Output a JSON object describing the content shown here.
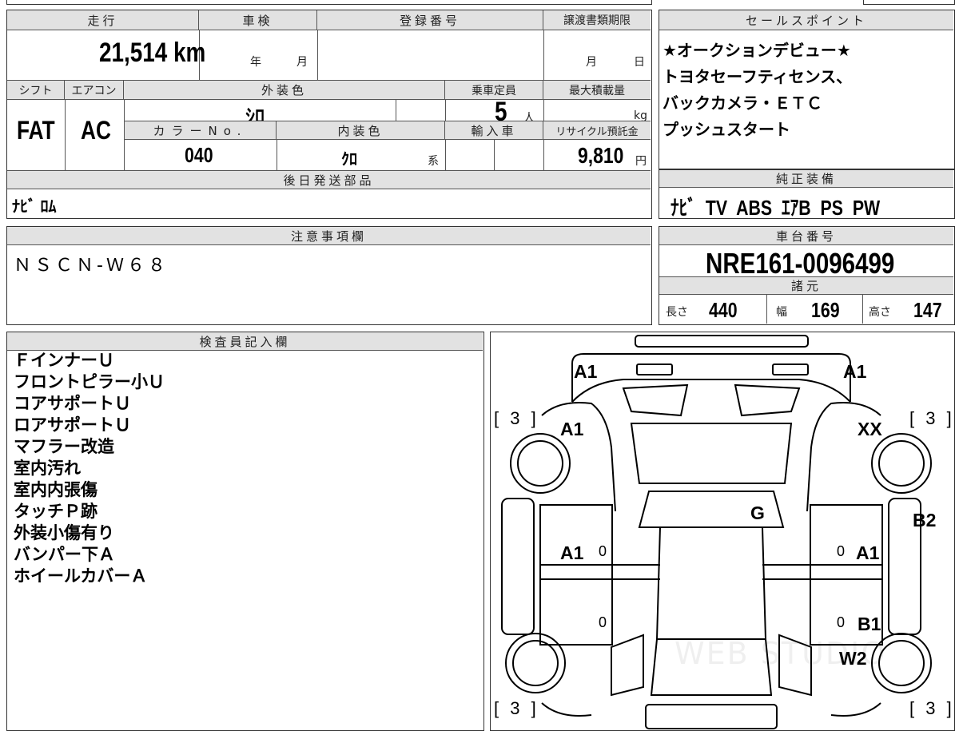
{
  "vehicle": {
    "mileage_label": "走行",
    "mileage": "21,514",
    "mileage_unit": "km",
    "inspection_label": "車検",
    "year_unit": "年",
    "month_unit": "月",
    "registration_label": "登録番号",
    "transfer_label": "譲渡書類期限",
    "shift_label": "シフト",
    "shift": "FAT",
    "aircon_label": "エアコン",
    "aircon": "AC",
    "exterior_color_label": "外装色",
    "exterior_color": "ｼﾛ",
    "capacity_label": "乗車定員",
    "capacity": "5",
    "capacity_unit": "人",
    "max_load_label": "最大積載量",
    "max_load_unit": "kg",
    "color_no_label": "カラーNo.",
    "color_no": "040",
    "interior_color_label": "内装色",
    "interior_color": "ｸﾛ",
    "interior_suffix": "系",
    "import_label": "輸入車",
    "recycle_label": "リサイクル預託金",
    "recycle_fee": "9,810",
    "recycle_unit": "円",
    "parts_label": "後日発送部品",
    "parts": "ﾅﾋﾞ ﾛﾑ"
  },
  "sales_points": {
    "label": "セールスポイント",
    "lines": [
      "★オークションデビュー★",
      "トヨタセーフティセンス、",
      "バックカメラ・ＥＴＣ",
      "プッシュスタート"
    ]
  },
  "equipment": {
    "label": "純正装備",
    "text": "ﾅﾋﾞ  TV  ABS  ｴｱB  PS  PW"
  },
  "caution": {
    "label": "注意事項欄",
    "text": "ＮＳＣＮ-Ｗ６８"
  },
  "chassis": {
    "label": "車台番号",
    "number": "NRE161-0096499",
    "specs_label": "諸元",
    "length_label": "長さ",
    "length": "440",
    "width_label": "幅",
    "width": "169",
    "height_label": "高さ",
    "height": "147"
  },
  "inspector": {
    "label": "検査員記入欄",
    "notes": [
      "ＦインナーＵ",
      "フロントピラー小Ｕ",
      "コアサポートＵ",
      "ロアサポートＵ",
      "マフラー改造",
      "室内汚れ",
      "室内内張傷",
      "タッチＰ跡",
      "外装小傷有り",
      "バンパー下Ａ",
      "ホイールカバーＡ"
    ]
  },
  "diagram": {
    "codes": {
      "front_left": "A1",
      "front_right": "A1",
      "fender_left": "A1",
      "fender_right": "XX",
      "roof": "G",
      "right_side": "B2",
      "door_front_left": "A1",
      "door_front_right": "A1",
      "door_rear_right": "B1",
      "wheel_rear_right": "W2"
    },
    "tread_marks": [
      "[ 3 ]",
      "[ 3 ]",
      "[ 3 ]",
      "[ 3 ]"
    ],
    "zero_marks": [
      "0",
      "0",
      "0",
      "0"
    ],
    "watermark": "WEB STUDIO"
  }
}
